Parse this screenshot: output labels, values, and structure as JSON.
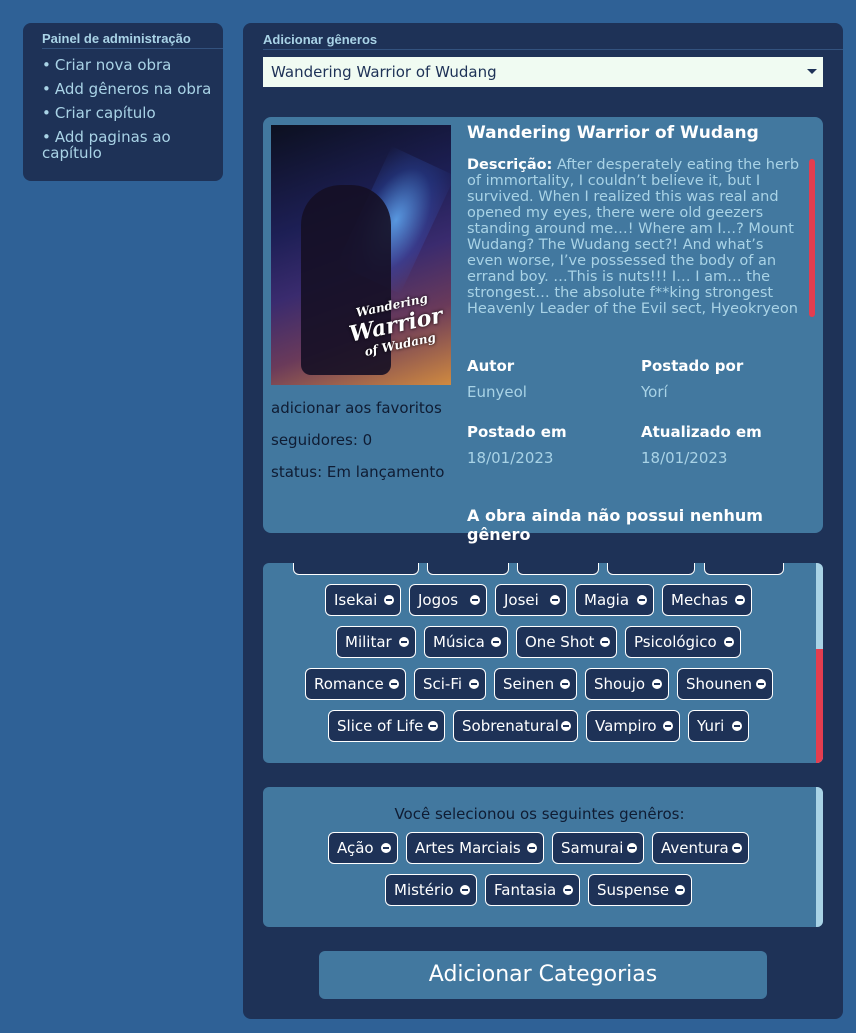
{
  "sidebar": {
    "title": "Painel de administração",
    "items": [
      {
        "bullet": "•",
        "label": "Criar nova obra"
      },
      {
        "bullet": "•",
        "label": "Add gêneros na obra"
      },
      {
        "bullet": "•",
        "label": "Criar capítulo"
      },
      {
        "bullet": "•",
        "label": "Add paginas ao capítulo"
      }
    ]
  },
  "main": {
    "title": "Adicionar gêneros",
    "selected_work": "Wandering Warrior of Wudang"
  },
  "work": {
    "title": "Wandering Warrior of Wudang",
    "cover_logo_line1": "Wandering",
    "cover_logo_line2": "Warrior",
    "cover_logo_line3": "of Wudang",
    "description_label": "Descrição:",
    "description": "After desperately eating the herb of immortality, I couldn’t believe it, but I survived. When I realized this was real and opened my eyes, there were old geezers standing around me…! Where am I…? Mount Wudang? The Wudang sect?! And what’s even worse, I’ve possessed the body of an errand boy. …This is nuts!!! I… I am… the strongest… the absolute f**king strongest Heavenly Leader of the Evil sect, Hyeokryeon Mugang!",
    "favorites": "adicionar aos favoritos",
    "followers": "seguidores: 0",
    "status": "status: Em lançamento",
    "author_label": "Autor",
    "author": "Eunyeol",
    "posted_by_label": "Postado por",
    "posted_by": "Yorí",
    "posted_at_label": "Postado em",
    "posted_at": "18/01/2023",
    "updated_at_label": "Atualizado em",
    "updated_at": "18/01/2023",
    "no_genre": "A obra ainda não possui nenhum gênero"
  },
  "available_genres": [
    "Isekai",
    "Jogos",
    "Josei",
    "Magia",
    "Mechas",
    "Militar",
    "Música",
    "One Shot",
    "Psicológico",
    "Romance",
    "Sci-Fi",
    "Seinen",
    "Shoujo",
    "Shounen",
    "Slice of Life",
    "Sobrenatural",
    "Vampiro",
    "Yuri"
  ],
  "selected": {
    "title": "Você selecionou os seguintes genêros:",
    "genres": [
      "Ação",
      "Artes Marciais",
      "Samurai",
      "Aventura",
      "Mistério",
      "Fantasia",
      "Suspense"
    ]
  },
  "submit_label": "Adicionar Categorias",
  "colors": {
    "background": "#2f6196",
    "panel": "#1e3257",
    "card": "#42789f",
    "accent_text": "#a9d3e6",
    "scroll_thumb": "#e43d4f"
  }
}
